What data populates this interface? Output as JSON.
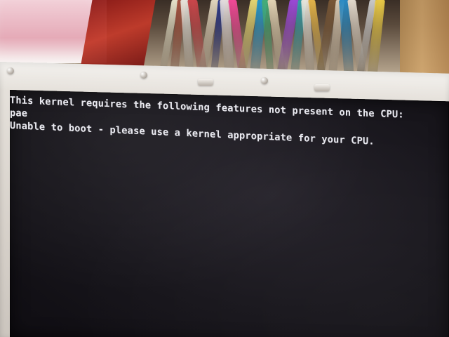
{
  "console": {
    "lines": [
      "This kernel requires the following features not present on the CPU:",
      "pae",
      "Unable to boot - please use a kernel appropriate for your CPU."
    ]
  },
  "background": {
    "book_colors": [
      "#f7f2d8",
      "#b05a46",
      "#f3f0e8",
      "#d44a4f",
      "#efe3c9",
      "#2e3d93",
      "#f1e9e8",
      "#ff4ea0",
      "#f2e27a",
      "#2aa1d6",
      "#49b67d",
      "#f0e0bf",
      "#a34de1",
      "#3aa8b2",
      "#f6f1e6",
      "#f2c04f",
      "#7f5c3a",
      "#e8d8c0",
      "#2b90cc",
      "#f0e6d8",
      "#d7d7d7",
      "#f4d34a"
    ]
  }
}
